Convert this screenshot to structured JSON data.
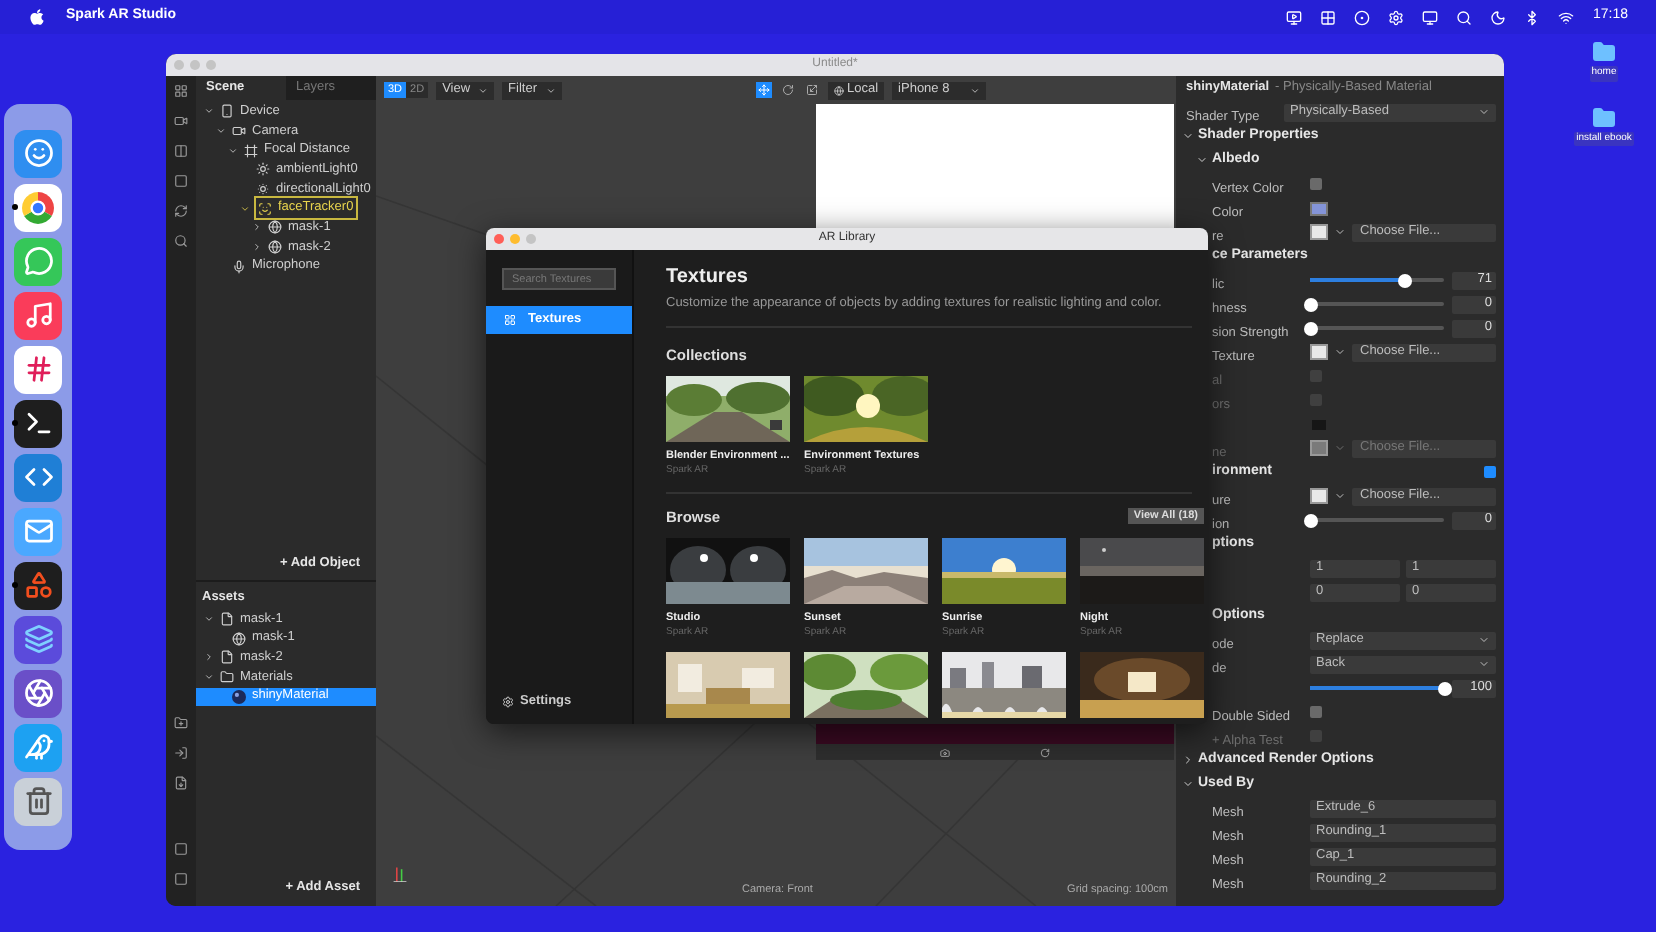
{
  "menu_bar": {
    "app_name": "Spark AR Studio",
    "clock": "17:18"
  },
  "desktop_icons": [
    {
      "label": "home"
    },
    {
      "label": "install ebook"
    }
  ],
  "dock": {
    "items": [
      {
        "kind": "finder",
        "running": false
      },
      {
        "kind": "browser",
        "running": true
      },
      {
        "kind": "messages",
        "running": false
      },
      {
        "kind": "music",
        "running": false
      },
      {
        "kind": "slack",
        "running": false
      },
      {
        "kind": "terminal",
        "running": true
      },
      {
        "kind": "code",
        "running": false
      },
      {
        "kind": "mail",
        "running": false
      },
      {
        "kind": "figma",
        "running": true
      },
      {
        "kind": "layers",
        "running": false
      },
      {
        "kind": "aperture",
        "running": false
      },
      {
        "kind": "bird",
        "running": false
      },
      {
        "kind": "trash",
        "running": false
      }
    ]
  },
  "window": {
    "title": "Untitled*"
  },
  "scene_panel": {
    "tabs": [
      {
        "label": "Scene",
        "selected": true
      },
      {
        "label": "Layers",
        "selected": false
      }
    ],
    "tree": [
      {
        "label": "Device",
        "kind": "device",
        "expanded": true,
        "selected": false,
        "children": [
          {
            "label": "Camera",
            "kind": "camera",
            "expanded": true,
            "selected": false,
            "children": [
              {
                "label": "Focal Distance",
                "kind": "focal",
                "expanded": true,
                "selected": false,
                "children": [
                  {
                    "label": "ambientLight0",
                    "kind": "light",
                    "selected": false
                  },
                  {
                    "label": "directionalLight0",
                    "kind": "dirlight",
                    "selected": false
                  },
                  {
                    "label": "faceTracker0",
                    "kind": "face",
                    "expanded": true,
                    "selected": true,
                    "children": [
                      {
                        "label": "mask-1",
                        "kind": "mesh",
                        "expanded": false,
                        "selected": false
                      },
                      {
                        "label": "mask-2",
                        "kind": "mesh",
                        "expanded": false,
                        "selected": false
                      }
                    ]
                  }
                ]
              }
            ]
          },
          {
            "label": "Microphone",
            "kind": "mic",
            "selected": false
          }
        ]
      }
    ],
    "add_object": "+ Add Object"
  },
  "assets_panel": {
    "title": "Assets",
    "tree": [
      {
        "label": "mask-1",
        "kind": "file",
        "expanded": true,
        "selected": false,
        "children": [
          {
            "label": "mask-1",
            "kind": "mesh",
            "selected": false
          }
        ]
      },
      {
        "label": "mask-2",
        "kind": "file",
        "expanded": false,
        "selected": false
      },
      {
        "label": "Materials",
        "kind": "folder",
        "expanded": true,
        "selected": false,
        "children": [
          {
            "label": "shinyMaterial",
            "kind": "material",
            "selected": true
          }
        ]
      }
    ],
    "add_asset": "+ Add Asset"
  },
  "viewport": {
    "modes": [
      {
        "label": "3D",
        "selected": true
      },
      {
        "label": "2D",
        "selected": false
      }
    ],
    "view_menu": "View",
    "filter_menu": "Filter",
    "tools": [
      {
        "kind": "move",
        "selected": true
      },
      {
        "kind": "rotate",
        "selected": false
      },
      {
        "kind": "scale",
        "selected": false
      }
    ],
    "space": "Local",
    "device": "iPhone 8",
    "camera": "Camera: Front",
    "grid": "Grid spacing: 100cm"
  },
  "inspector": {
    "title": "shinyMaterial",
    "subtitle": "- Physically-Based Material",
    "rows": [
      {
        "kind": "dropdown",
        "label": "Shader Type",
        "value": "Physically-Based",
        "disabled": false
      },
      {
        "kind": "section",
        "label": "Shader Properties",
        "expanded": true,
        "disabled": false,
        "children": [
          {
            "kind": "section",
            "label": "Albedo",
            "expanded": true,
            "disabled": false,
            "children": [
              {
                "kind": "checkbox",
                "label": "Vertex Color",
                "checked": false,
                "disabled": false
              },
              {
                "kind": "color",
                "label": "Color",
                "color": "#8494d8",
                "disabled": false
              },
              {
                "kind": "file",
                "label": "re",
                "color": "#e8e8e8",
                "button": "Choose File...",
                "disabled": false
              }
            ]
          },
          {
            "kind": "section",
            "label": "ce Parameters",
            "disabled": false,
            "children": [
              {
                "kind": "slider",
                "label": "lic",
                "level": 0.71,
                "reading": "71",
                "disabled": false
              },
              {
                "kind": "slider",
                "label": "hness",
                "level": 0,
                "reading": "0",
                "disabled": false
              },
              {
                "kind": "slider",
                "label": "sion Strength",
                "level": 0,
                "reading": "0",
                "disabled": false
              },
              {
                "kind": "file",
                "label": "Texture",
                "color": "#e8e8e8",
                "button": "Choose File...",
                "disabled": false
              },
              {
                "kind": "checkbox",
                "label": "al",
                "checked": false,
                "disabled": true
              },
              {
                "kind": "checkbox",
                "label": "ors",
                "checked": false,
                "disabled": true
              },
              {
                "kind": "color",
                "color": "#161616",
                "disabled": true
              },
              {
                "kind": "file",
                "label": "ne",
                "color": "#7a7a7a",
                "button": "Choose File...",
                "disabled": true
              }
            ]
          },
          {
            "kind": "section",
            "label": "ironment",
            "checked": true,
            "disabled": false,
            "children": [
              {
                "kind": "file",
                "label": "ure",
                "color": "#e8e8e8",
                "button": "Choose File...",
                "disabled": false
              },
              {
                "kind": "slider",
                "label": "ion",
                "level": 0,
                "reading": "0",
                "disabled": false
              }
            ]
          },
          {
            "kind": "section",
            "label": "ptions",
            "disabled": false,
            "children": [
              {
                "kind": "inputs",
                "values": [
                  "1",
                  "1"
                ],
                "disabled": false
              },
              {
                "kind": "inputs",
                "values": [
                  "0",
                  "0"
                ],
                "disabled": false
              }
            ]
          },
          {
            "kind": "section",
            "label": "Options",
            "disabled": false,
            "children": [
              {
                "kind": "dropdown",
                "label": "ode",
                "value": "Replace",
                "disabled": false
              },
              {
                "kind": "dropdown",
                "label": "de",
                "value": "Back",
                "disabled": false
              },
              {
                "kind": "slider",
                "level": 1,
                "reading": "100",
                "disabled": false
              },
              {
                "kind": "checkbox",
                "label": "Double Sided",
                "checked": false,
                "disabled": false
              },
              {
                "kind": "checkbox",
                "label": "+ Alpha Test",
                "checked": false,
                "disabled": true
              }
            ]
          }
        ]
      },
      {
        "kind": "section",
        "label": "Advanced Render Options",
        "expanded": false,
        "disabled": false
      },
      {
        "kind": "section",
        "label": "Used By",
        "expanded": true,
        "disabled": false,
        "children": [
          {
            "kind": "text_field",
            "label": "Mesh",
            "value": "Extrude_6",
            "disabled": false
          },
          {
            "kind": "text_field",
            "label": "Mesh",
            "value": "Rounding_1",
            "disabled": false
          },
          {
            "kind": "text_field",
            "label": "Mesh",
            "value": "Cap_1",
            "disabled": false
          },
          {
            "kind": "text_field",
            "label": "Mesh",
            "value": "Rounding_2",
            "disabled": false
          }
        ]
      }
    ]
  },
  "library": {
    "title": "AR Library",
    "search_placeholder": "Search Textures",
    "nav": [
      {
        "label": "Textures",
        "selected": true
      }
    ],
    "settings": "Settings",
    "heading": "Textures",
    "description": "Customize the appearance of objects by adding textures for realistic lighting and color.",
    "collections": {
      "title": "Collections",
      "items": [
        {
          "name": "Blender Environment ...",
          "author": "Spark AR"
        },
        {
          "name": "Environment Textures",
          "author": "Spark AR"
        }
      ]
    },
    "browse": {
      "title": "Browse",
      "view_all": "View All (18)",
      "items": [
        {
          "kind": "card",
          "name": "Studio",
          "author": "Spark AR"
        },
        {
          "kind": "card",
          "name": "Sunset",
          "author": "Spark AR"
        },
        {
          "kind": "card",
          "name": "Sunrise",
          "author": "Spark AR"
        },
        {
          "kind": "card",
          "name": "Night",
          "author": "Spark AR"
        },
        {
          "kind": "picture"
        },
        {
          "kind": "picture"
        },
        {
          "kind": "picture"
        },
        {
          "kind": "picture"
        }
      ]
    }
  }
}
